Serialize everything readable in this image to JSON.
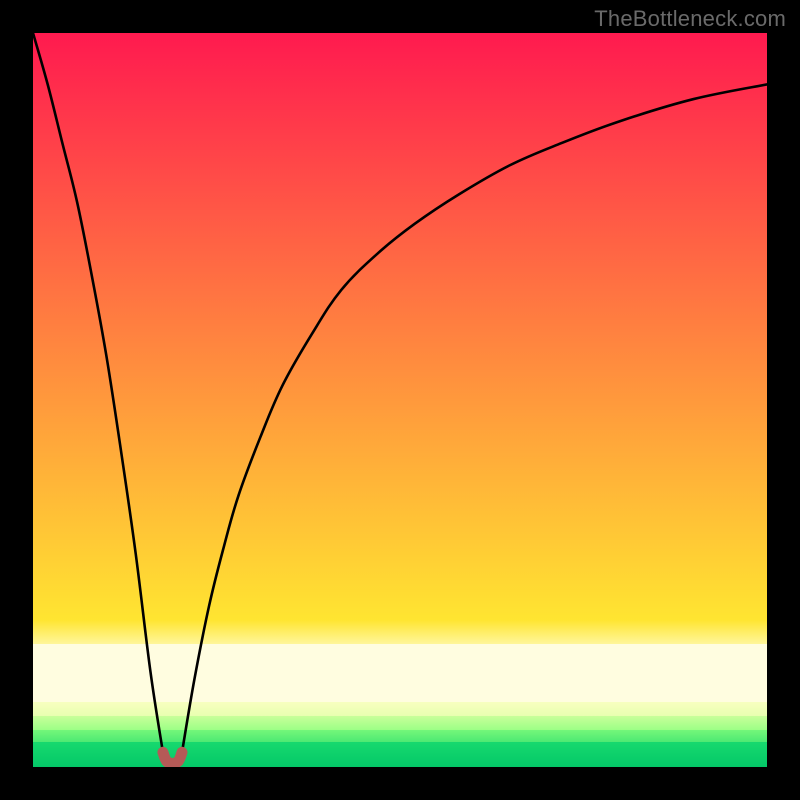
{
  "watermark": "TheBottleneck.com",
  "colors": {
    "black": "#000000",
    "curve": "#000000",
    "marker": "#b55a57"
  },
  "gradient_bands": [
    {
      "top_pct": 0,
      "height_pct": 80,
      "from": "#ff1a4f",
      "to": "#ffe531"
    },
    {
      "top_pct": 80,
      "height_pct": 3.2,
      "from": "#ffe531",
      "to": "#fff69a"
    },
    {
      "top_pct": 83.2,
      "height_pct": 8.0,
      "from": "#fffde0",
      "to": "#fffde0"
    },
    {
      "top_pct": 91.2,
      "height_pct": 1.8,
      "from": "#f8ffc0",
      "to": "#e8ffb0"
    },
    {
      "top_pct": 93.0,
      "height_pct": 2.0,
      "from": "#c8ff9a",
      "to": "#9cff86"
    },
    {
      "top_pct": 95.0,
      "height_pct": 1.6,
      "from": "#74f77a",
      "to": "#4de973"
    },
    {
      "top_pct": 96.6,
      "height_pct": 3.4,
      "from": "#17d96e",
      "to": "#04c868"
    }
  ],
  "chart_data": {
    "type": "line",
    "title": "",
    "xlabel": "",
    "ylabel": "",
    "xlim": [
      0,
      100
    ],
    "ylim": [
      0,
      100
    ],
    "grid": false,
    "legend": false,
    "annotations": [
      "TheBottleneck.com"
    ],
    "series": [
      {
        "name": "left-branch",
        "x": [
          0,
          2,
          4,
          6,
          8,
          10,
          12,
          14,
          16,
          17.7
        ],
        "y": [
          100,
          93,
          85,
          77,
          67,
          56,
          43,
          29,
          13,
          2
        ]
      },
      {
        "name": "right-branch",
        "x": [
          20.3,
          22,
          24,
          26,
          28,
          31,
          34,
          38,
          42,
          47,
          52,
          58,
          65,
          72,
          80,
          90,
          100
        ],
        "y": [
          2,
          12,
          22,
          30,
          37,
          45,
          52,
          59,
          65,
          70,
          74,
          78,
          82,
          85,
          88,
          91,
          93
        ]
      },
      {
        "name": "bottom-marker",
        "x": [
          17.7,
          18.2,
          19.0,
          19.8,
          20.3
        ],
        "y": [
          2.0,
          0.8,
          0.5,
          0.8,
          2.0
        ]
      }
    ],
    "minimum": {
      "x": 19,
      "y": 0.5
    }
  }
}
